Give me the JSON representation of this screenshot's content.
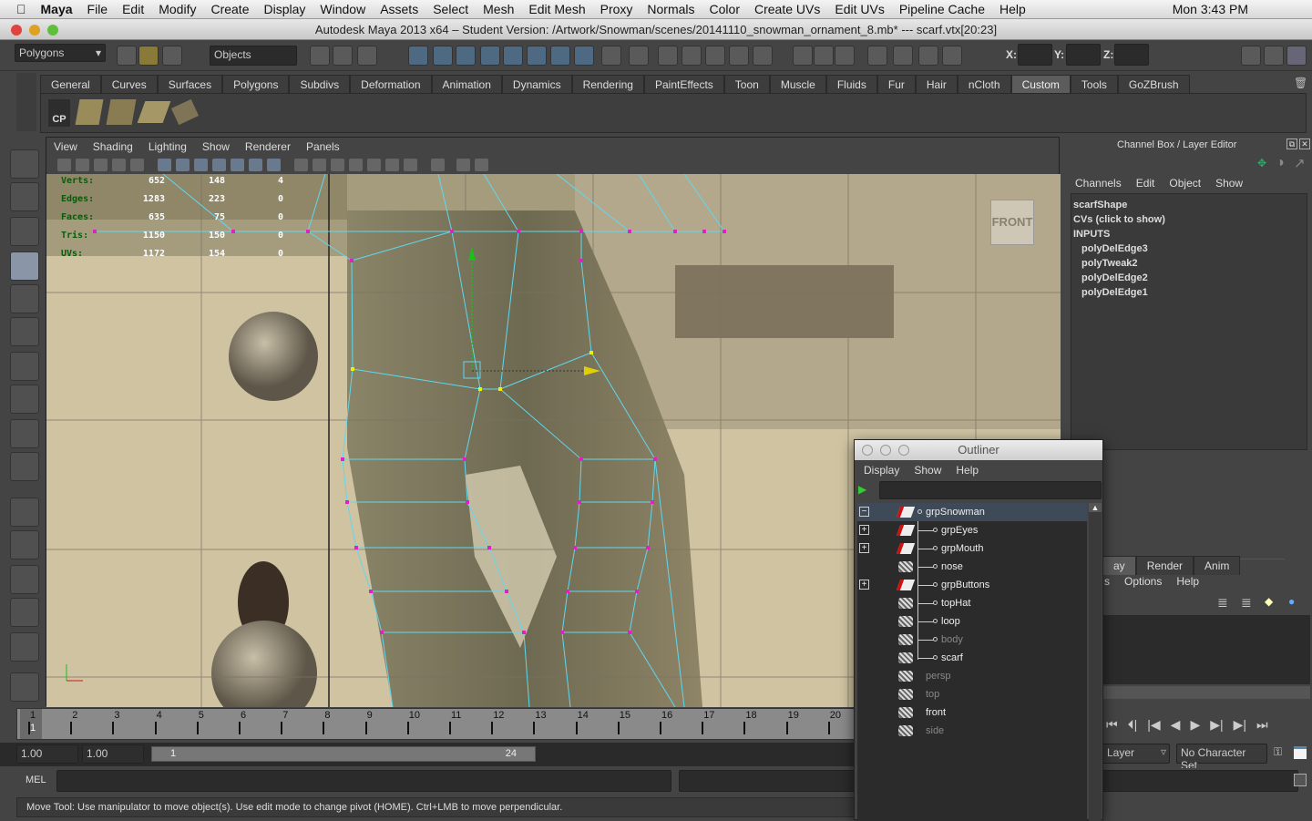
{
  "macmenu": {
    "app": "Maya",
    "items": [
      "File",
      "Edit",
      "Modify",
      "Create",
      "Display",
      "Window",
      "Assets",
      "Select",
      "Mesh",
      "Edit Mesh",
      "Proxy",
      "Normals",
      "Color",
      "Create UVs",
      "Edit UVs",
      "Pipeline Cache",
      "Help"
    ],
    "clock": "Mon 3:43 PM"
  },
  "window": {
    "title": "Autodesk Maya 2013 x64 – Student Version: /Artwork/Snowman/scenes/20141110_snowman_ornament_8.mb*  ---   scarf.vtx[20:23]"
  },
  "statusline": {
    "menuset": "Polygons",
    "selection_mode": "Objects",
    "x_label": "X:",
    "y_label": "Y:",
    "z_label": "Z:",
    "x": "",
    "y": "",
    "z": ""
  },
  "shelf": {
    "tabs": [
      "General",
      "Curves",
      "Surfaces",
      "Polygons",
      "Subdivs",
      "Deformation",
      "Animation",
      "Dynamics",
      "Rendering",
      "PaintEffects",
      "Toon",
      "Muscle",
      "Fluids",
      "Fur",
      "Hair",
      "nCloth",
      "Custom",
      "Tools",
      "GoZBrush"
    ],
    "active": "Custom",
    "cp_label": "CP"
  },
  "viewport": {
    "menu": [
      "View",
      "Shading",
      "Lighting",
      "Show",
      "Renderer",
      "Panels"
    ],
    "camera_label": "FRONT",
    "hud": [
      {
        "label": "Verts:",
        "a": "652",
        "b": "148",
        "c": "4"
      },
      {
        "label": "Edges:",
        "a": "1283",
        "b": "223",
        "c": "0"
      },
      {
        "label": "Faces:",
        "a": "635",
        "b": "75",
        "c": "0"
      },
      {
        "label": "Tris:",
        "a": "1150",
        "b": "150",
        "c": "0"
      },
      {
        "label": "UVs:",
        "a": "1172",
        "b": "154",
        "c": "0"
      }
    ]
  },
  "channelbox": {
    "title": "Channel Box / Layer Editor",
    "menu": [
      "Channels",
      "Edit",
      "Object",
      "Show"
    ],
    "items": [
      "scarfShape",
      "CVs (click to show)",
      "INPUTS",
      "polyDelEdge3",
      "polyTweak2",
      "polyDelEdge2",
      "polyDelEdge1"
    ]
  },
  "layereditor": {
    "tabs": [
      "ay",
      "Render",
      "Anim"
    ],
    "menu": [
      "s",
      "Options",
      "Help"
    ]
  },
  "outliner": {
    "title": "Outliner",
    "menu": [
      "Display",
      "Show",
      "Help"
    ],
    "filter": "",
    "items": [
      {
        "name": "grpSnowman",
        "type": "group",
        "expander": "minus",
        "selected": true,
        "indent": 0,
        "dim": false
      },
      {
        "name": "grpEyes",
        "type": "group",
        "expander": "plus",
        "indent": 1,
        "dim": false
      },
      {
        "name": "grpMouth",
        "type": "group",
        "expander": "plus",
        "indent": 1,
        "dim": false
      },
      {
        "name": "nose",
        "type": "mesh",
        "expander": "",
        "indent": 1,
        "dim": false
      },
      {
        "name": "grpButtons",
        "type": "group",
        "expander": "plus",
        "indent": 1,
        "dim": false
      },
      {
        "name": "topHat",
        "type": "mesh",
        "expander": "",
        "indent": 1,
        "dim": false
      },
      {
        "name": "loop",
        "type": "mesh",
        "expander": "",
        "indent": 1,
        "dim": false
      },
      {
        "name": "body",
        "type": "mesh",
        "expander": "",
        "indent": 1,
        "dim": true
      },
      {
        "name": "scarf",
        "type": "mesh",
        "expander": "",
        "indent": 1,
        "dim": false
      },
      {
        "name": "persp",
        "type": "camera",
        "expander": "",
        "indent": 0,
        "dim": true
      },
      {
        "name": "top",
        "type": "camera",
        "expander": "",
        "indent": 0,
        "dim": true
      },
      {
        "name": "front",
        "type": "camera",
        "expander": "",
        "indent": 0,
        "dim": false
      },
      {
        "name": "side",
        "type": "camera",
        "expander": "",
        "indent": 0,
        "dim": true
      }
    ]
  },
  "timeline": {
    "ticks": [
      "1",
      "2",
      "3",
      "4",
      "5",
      "6",
      "7",
      "8",
      "9",
      "10",
      "11",
      "12",
      "13",
      "14",
      "15",
      "16",
      "17",
      "18",
      "19",
      "20"
    ],
    "current_frame": "1"
  },
  "range": {
    "start": "1.00",
    "playback_start": "1.00",
    "slider_start": "1",
    "slider_end": "24",
    "anim_layer": "n Layer",
    "character_set": "No Character Set"
  },
  "mel": {
    "label": "MEL",
    "command": ""
  },
  "helpline": "Move Tool: Use manipulator to move object(s). Use edit mode to change pivot (HOME).  Ctrl+LMB to move perpendicular.",
  "colors": {
    "wire": "#5fd8ee",
    "vertex": "#e020c0",
    "selected_vertex": "#f0f000",
    "outliner_selection": "#3f4a58"
  }
}
